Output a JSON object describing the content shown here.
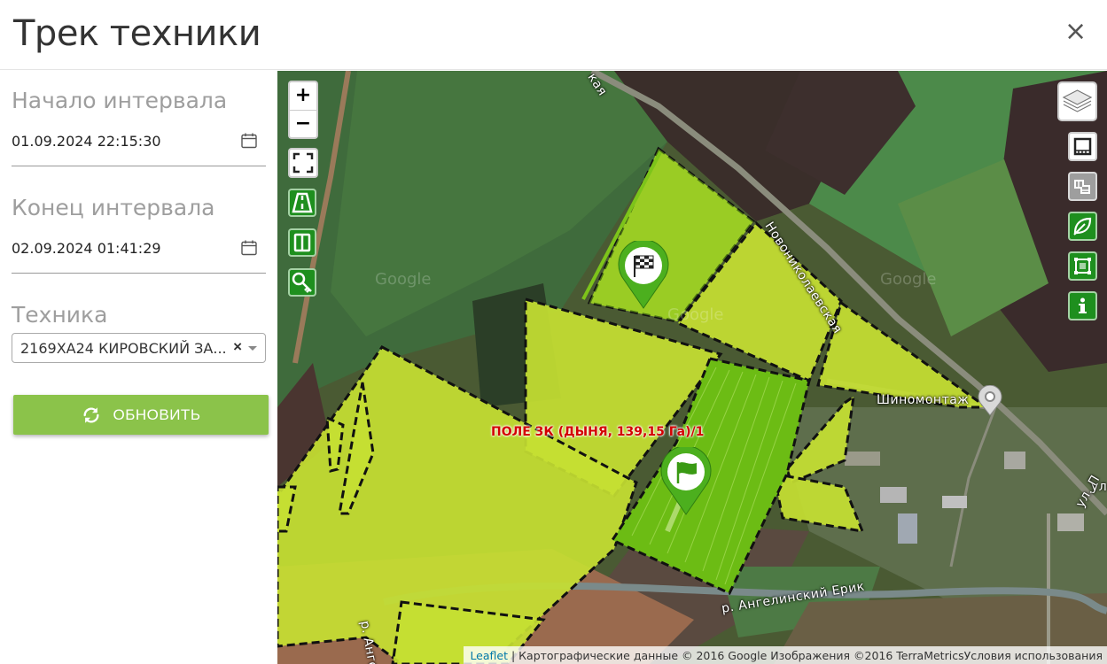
{
  "modal": {
    "title": "Трек техники",
    "close_label": "×"
  },
  "form": {
    "start": {
      "label": "Начало интервала",
      "value": "01.09.2024 22:15:30"
    },
    "end": {
      "label": "Конец интервала",
      "value": "02.09.2024 01:41:29"
    },
    "vehicle": {
      "label": "Техника",
      "value": "2169ХА24 КИРОВСКИЙ ЗА...",
      "clear": "×"
    },
    "refresh_label": "ОБНОВИТЬ"
  },
  "map": {
    "zoom_in": "+",
    "zoom_out": "−",
    "field_label": "ПОЛЕ 3К (ДЫНЯ, 139,15 Га)/1",
    "roads": {
      "top": "Новониколаевская",
      "top_left": "кая",
      "place": "Шиномонтаж",
      "river": "р. Ангелинский Ерик",
      "river_left": "р. Анге",
      "right1": "ул",
      "right2": "ул. П"
    },
    "watermarks": [
      "Google",
      "Google",
      "Google"
    ],
    "attribution": {
      "leaflet": "Leaflet",
      "text": " | Картографические данные © 2016 Google Изображения ©2016 TerraMetricsУсловия использования"
    }
  },
  "colors": {
    "field_fill": "#c6e032",
    "track_fill": "#6cbc14",
    "accent_green": "#8bc34a",
    "tool_green": "#1e8f1e"
  },
  "icons": [
    "calendar-icon",
    "refresh-icon",
    "layers-icon",
    "ruler-icon",
    "grid-icon",
    "leaf-icon",
    "select-area-icon",
    "info-icon",
    "fullscreen-icon",
    "road-icon",
    "columns-icon",
    "key-icon",
    "finish-flag-icon",
    "start-flag-icon",
    "location-pin-icon"
  ]
}
